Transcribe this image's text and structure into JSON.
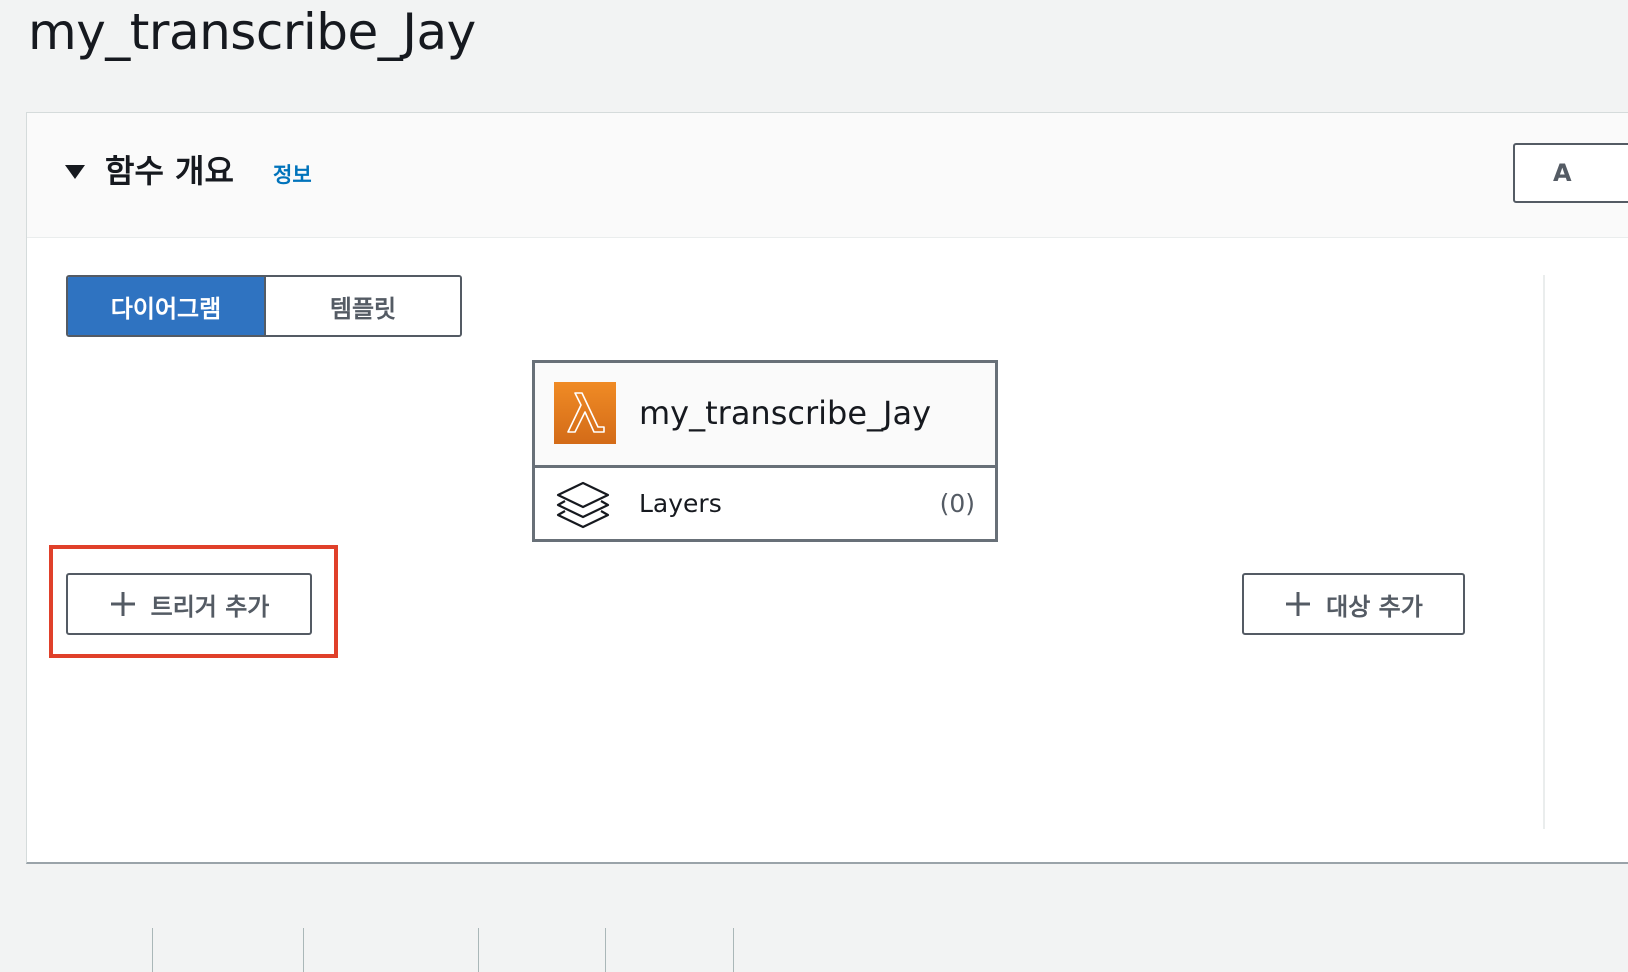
{
  "page": {
    "title": "my_transcribe_Jay"
  },
  "overview": {
    "title": "함수 개요",
    "info_link": "정보",
    "header_action_label": "A"
  },
  "view_toggle": {
    "options": [
      {
        "label": "다이어그램",
        "selected": true
      },
      {
        "label": "템플릿",
        "selected": false
      }
    ]
  },
  "function_card": {
    "name": "my_transcribe_Jay",
    "icon": "lambda-icon",
    "layers_label": "Layers",
    "layers_count": "(0)"
  },
  "actions": {
    "add_trigger": "트리거 추가",
    "add_destination": "대상 추가"
  },
  "colors": {
    "accent": "#2f73c1",
    "highlight": "#e0402a",
    "lambda_orange": "#e47a1f",
    "link": "#0073bb"
  }
}
